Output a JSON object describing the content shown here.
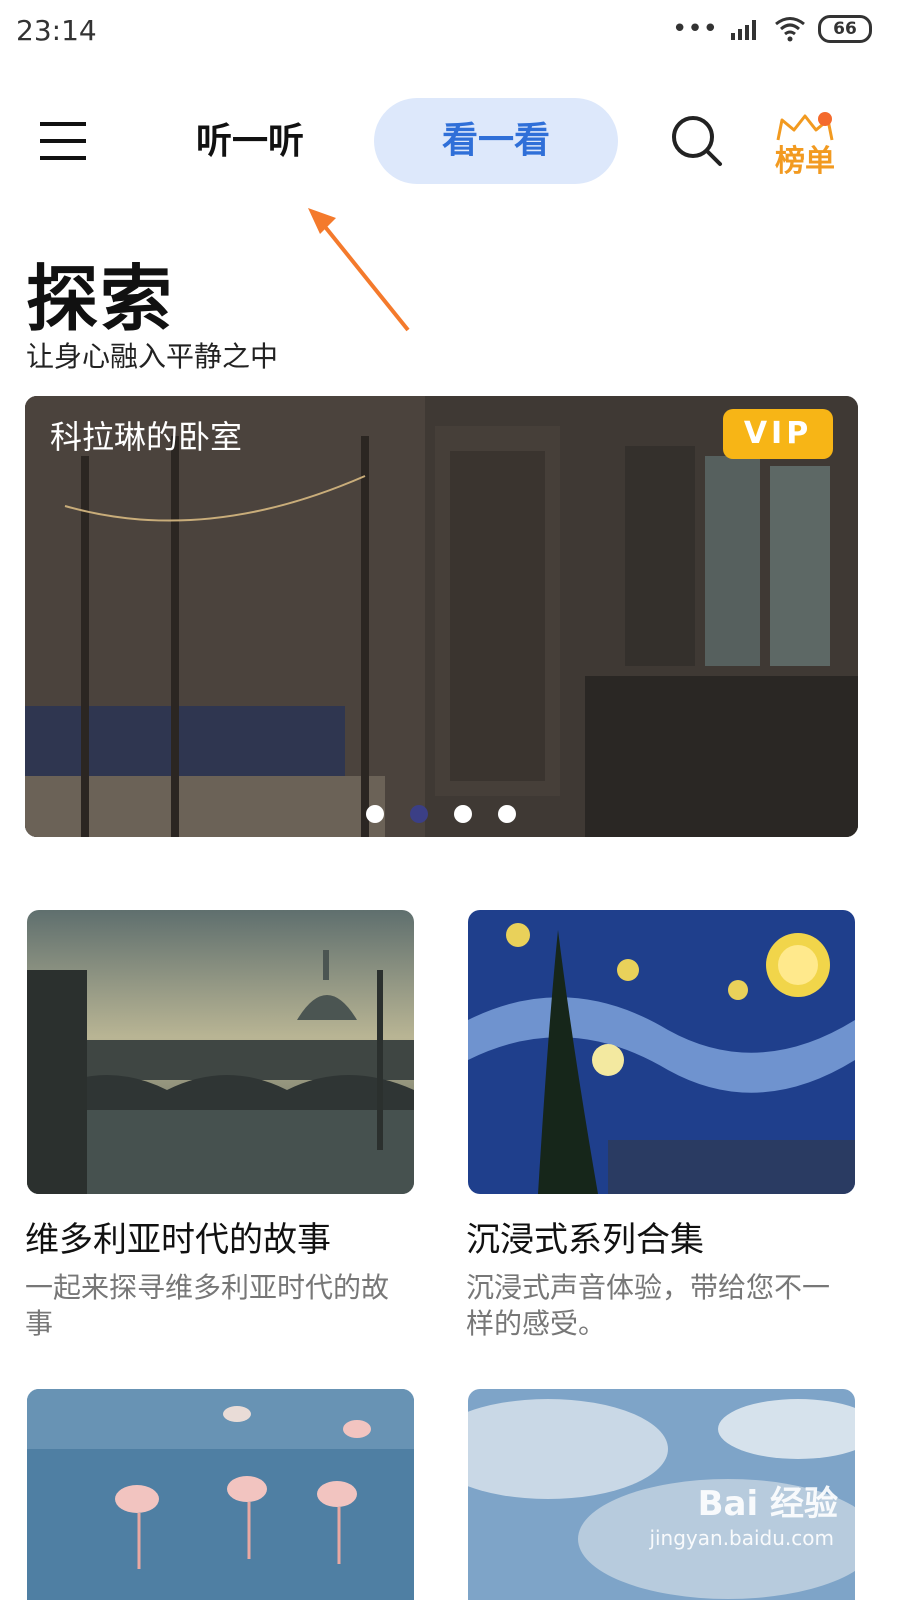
{
  "status_bar": {
    "time": "23:14",
    "battery": "66",
    "signal_dots": "•••"
  },
  "nav": {
    "menu_icon": "menu-icon",
    "tab_listen": "听一听",
    "tab_watch": "看一看",
    "search_icon": "search-icon",
    "rank_label": "榜单"
  },
  "header": {
    "title": "探索",
    "subtitle": "让身心融入平静之中"
  },
  "hero": {
    "title": "科拉琳的卧室",
    "badge": "VIP",
    "carousel_pages": 4,
    "active_page": 2
  },
  "cards": [
    {
      "title": "维多利亚时代的故事",
      "desc_line1": "一起来探寻维多利亚时代的故",
      "desc_line2": "事"
    },
    {
      "title": "沉浸式系列合集",
      "desc_line1": "沉浸式声音体验，带给您不一",
      "desc_line2": "样的感受。"
    }
  ],
  "watermark": {
    "brand": "Bai 经验",
    "url": "jingyan.baidu.com"
  },
  "colors": {
    "accent": "#2f6fd8",
    "tab_bg": "#dde8fb",
    "vip": "#f7b516",
    "rank": "#f29a20",
    "arrow": "#f47a2c"
  }
}
